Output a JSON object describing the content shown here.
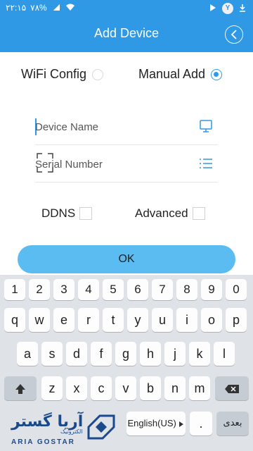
{
  "status_bar": {
    "time": "۲۲:۱۵",
    "battery": "۷۸%",
    "notif_badge": "Y"
  },
  "header": {
    "title": "Add Device",
    "back_icon": "chevron-left-icon"
  },
  "mode": {
    "wifi_label": "WiFi Config",
    "manual_label": "Manual Add",
    "selected": "manual"
  },
  "fields": {
    "device_name_placeholder": "Device Name",
    "serial_number_placeholder": "Serial Number"
  },
  "options": {
    "ddns_label": "DDNS",
    "advanced_label": "Advanced"
  },
  "ok_label": "OK",
  "keyboard": {
    "number_row": [
      "1",
      "2",
      "3",
      "4",
      "5",
      "6",
      "7",
      "8",
      "9",
      "0"
    ],
    "row1": [
      "q",
      "w",
      "e",
      "r",
      "t",
      "y",
      "u",
      "i",
      "o",
      "p"
    ],
    "row2": [
      "a",
      "s",
      "d",
      "f",
      "g",
      "h",
      "j",
      "k",
      "l"
    ],
    "row3": [
      "z",
      "x",
      "c",
      "v",
      "b",
      "n",
      "m"
    ],
    "space_label": "English(US)",
    "period_label": ".",
    "next_label": "بعدی"
  },
  "watermark": {
    "brand_fa": "آریا گستر",
    "brand_sub": "الکترونیک",
    "brand_latin": "ARIA GOSTAR"
  },
  "colors": {
    "primary": "#2f99e6",
    "button": "#5bbcf2",
    "keyboard_bg": "#dfe3e8"
  }
}
